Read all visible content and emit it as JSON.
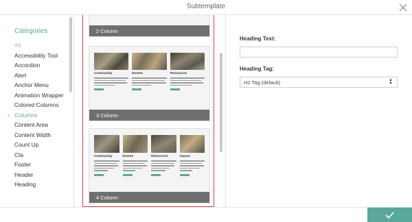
{
  "header": {
    "title": "Subtemplate"
  },
  "sidebar": {
    "title": "Categories",
    "items": [
      {
        "label": "All",
        "state": "muted"
      },
      {
        "label": "Accessibility Tool",
        "state": ""
      },
      {
        "label": "Accordion",
        "state": ""
      },
      {
        "label": "Alert",
        "state": ""
      },
      {
        "label": "Anchor Menu",
        "state": ""
      },
      {
        "label": "Animation Wrapper",
        "state": ""
      },
      {
        "label": "Colored Columns",
        "state": ""
      },
      {
        "label": "Columns",
        "state": "active"
      },
      {
        "label": "Content Area",
        "state": ""
      },
      {
        "label": "Content Width",
        "state": ""
      },
      {
        "label": "Count Up",
        "state": ""
      },
      {
        "label": "Cta",
        "state": ""
      },
      {
        "label": "Footer",
        "state": ""
      },
      {
        "label": "Header",
        "state": ""
      },
      {
        "label": "Heading",
        "state": ""
      }
    ]
  },
  "templates": {
    "two_col": {
      "label": "2 Column"
    },
    "three_col": {
      "label": "3 Column",
      "columns": [
        "Community",
        "Events",
        "Resources"
      ]
    },
    "four_col": {
      "label": "4 Column",
      "columns": [
        "Community",
        "Events",
        "Resources",
        "Impact"
      ]
    }
  },
  "form": {
    "heading_text_label": "Heading Text:",
    "heading_text_value": "",
    "heading_tag_label": "Heading Tag:",
    "heading_tag_value": "H2 Tag (default)"
  },
  "icons": {
    "close": "close-icon",
    "confirm": "checkmark-icon",
    "chevron": "chevron-right-icon",
    "select_arrows": "sort-arrows-icon"
  },
  "colors": {
    "accent": "#5aa89a",
    "selection": "#e33c3c",
    "card_bar": "#6f6f6f"
  }
}
